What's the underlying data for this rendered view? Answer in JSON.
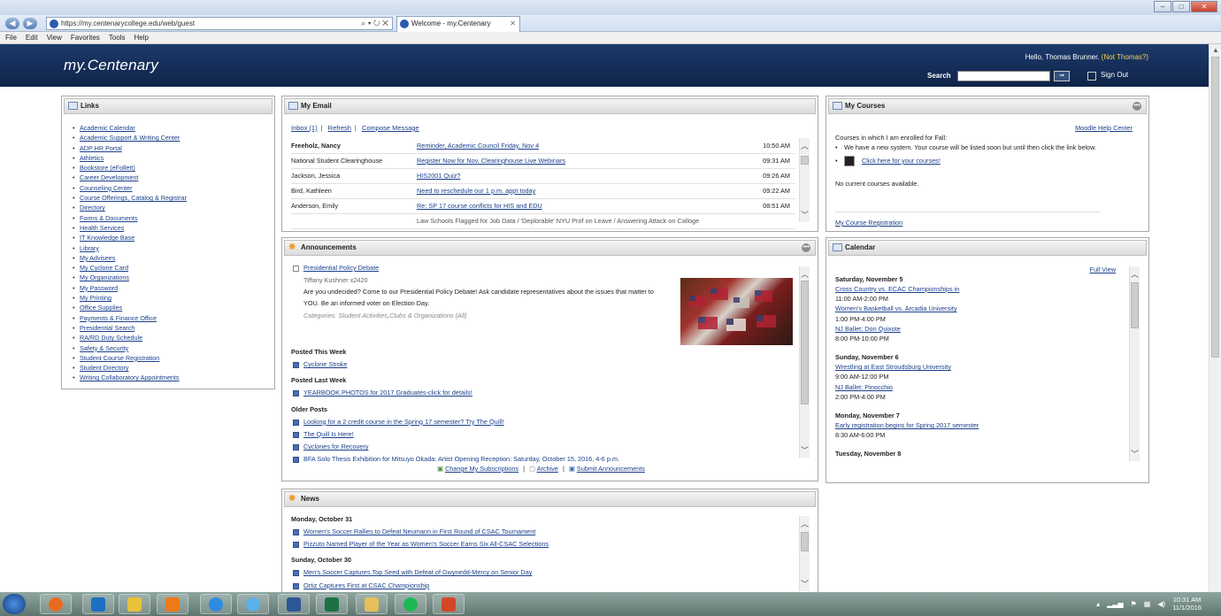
{
  "browser": {
    "url": "https://my.centenarycollege.edu/web/guest",
    "tab_title": "Welcome - my.Centenary",
    "menu": [
      "File",
      "Edit",
      "View",
      "Favorites",
      "Tools",
      "Help"
    ]
  },
  "header": {
    "logo": "my.Centenary",
    "greeting": "Hello, Thomas Brunner.",
    "not_user": "(Not Thomas?)",
    "search_label": "Search",
    "search_go": "Go",
    "sign_out": "Sign Out"
  },
  "links": {
    "title": "Links",
    "items": [
      "Academic Calendar",
      "Academic Support & Writing Center",
      "ADP HR Portal",
      "Athletics",
      "Bookstore (eFollett)",
      "Career Development",
      "Counseling Center",
      "Course Offerings, Catalog & Registrar",
      "Directory",
      "Forms & Documents",
      "Health Services",
      "IT Knowledge Base",
      "Library",
      "My Advisees",
      "My Cyclone Card",
      "My Organizations",
      "My Password",
      "My Printing",
      "Office Supplies",
      "Payments & Finance Office",
      "Presidential Search",
      "RA/RD Duty Schedule",
      "Safety & Security",
      "Student Course Registration",
      "Student Directory",
      "Writing Collaboratory Appointments"
    ]
  },
  "email": {
    "title": "My Email",
    "inbox": "Inbox (1)",
    "refresh": "Refresh",
    "compose": "Compose Message",
    "rows": [
      {
        "from": "Freeholz, Nancy",
        "subject": "Reminder, Academic Council Friday, Nov 4",
        "time": "10:50 AM"
      },
      {
        "from": "National Student Clearinghouse",
        "subject": "Register Now for Nov. Clearinghouse Live Webinars",
        "time": "09:31 AM"
      },
      {
        "from": "Jackson, Jessica",
        "subject": "HIS2001 Quiz?",
        "time": "09:26 AM"
      },
      {
        "from": "Bird, Kathleen",
        "subject": "Need to reschedule our 1 p.m. appt today",
        "time": "09:22 AM"
      },
      {
        "from": "Anderson, Emily",
        "subject": "Re: SP 17 course conflicts for HIS and EDU",
        "time": "08:51 AM"
      },
      {
        "from": "",
        "subject": "Law Schools Flagged for Job Data / 'Deplorable' NYU Prof on Leave / Answering Attack on Calloge",
        "time": ""
      }
    ]
  },
  "announcements": {
    "title": "Announcements",
    "featured_title": "Presidential Policy Debate",
    "featured_author": "Tiffany Kushner x2420",
    "featured_body": "Are you undecided? Come to our Presidential Policy Debate! Ask candidate representatives about the issues that matter to YOU. Be an informed voter on Election Day.",
    "featured_categories": "Categories: Student Activities,Clubs & Organizations (All)",
    "this_week_label": "Posted This Week",
    "this_week": [
      "Cyclone Stroke"
    ],
    "last_week_label": "Posted Last Week",
    "last_week": [
      "YEARBOOK PHOTOS for 2017 Graduates-click for details!"
    ],
    "older_label": "Older Posts",
    "older": [
      "Looking for a 2 credit course in the Spring 17 semester? Try The Quill!",
      "The Quill Is Here!",
      "Cyclones for Recovery",
      "BFA Solo Thesis Exhibition for Mitsuyo Okada: Artist Opening Reception: Saturday, October 15, 2016, 4-6 p.m."
    ],
    "change_subscriptions": "Change My Subscriptions",
    "archive": "Archive",
    "submit": "Submit Announcements"
  },
  "news": {
    "title": "News",
    "day1": "Monday, October 31",
    "day1_items": [
      "Women's Soccer Rallies to Defeat Neumann in First Round of CSAC Tournament",
      "Pizzuto Named Player of the Year as Women's Soccer Earns Six All-CSAC Selections"
    ],
    "day2": "Sunday, October 30",
    "day2_items": [
      "Men's Soccer Captures Top Seed with Defeat of Gwynedd-Mercy on Senior Day",
      "Ortiz Captures First at CSAC Championship"
    ]
  },
  "courses": {
    "title": "My Courses",
    "help_link": "Moodle Help Center",
    "enrolled_text": "Courses in which I am enrolled for Fall:",
    "bullet1": "We have a new system. Your course will be listed soon but until then click the link below.",
    "bullet2": "Click here for your courses!",
    "none_text": "No current courses available.",
    "registration": "My Course Registration"
  },
  "calendar": {
    "title": "Calendar",
    "full_view": "Full View",
    "days": [
      {
        "day": "Saturday, November 5",
        "events": [
          {
            "title": "Cross Country vs. ECAC Championships in",
            "time": "11:00 AM-2:00 PM"
          },
          {
            "title": "Women's Basketball vs. Arcadia University",
            "time": "1:00 PM-4:00 PM"
          },
          {
            "title": "NJ Ballet: Don Quixote",
            "time": "8:00 PM-10:00 PM"
          }
        ]
      },
      {
        "day": "Sunday, November 6",
        "events": [
          {
            "title": "Wrestling at East Stroudsburg University",
            "time": "9:00 AM-12:00 PM"
          },
          {
            "title": "NJ Ballet: Pinocchio",
            "time": "2:00 PM-4:00 PM"
          }
        ]
      },
      {
        "day": "Monday, November 7",
        "events": [
          {
            "title": "Early registration begins for Spring 2017 semester",
            "time": "8:30 AM-6:00 PM"
          }
        ]
      }
    ],
    "next_day": "Tuesday, November 8"
  },
  "taskbar": {
    "time": "10:31 AM",
    "date": "11/1/2016"
  },
  "colors": {
    "header_bg": "#1c3a6b",
    "link": "#1a3f8c",
    "accent_orange": "#f39b2d",
    "not_user": "#ffd24a"
  }
}
